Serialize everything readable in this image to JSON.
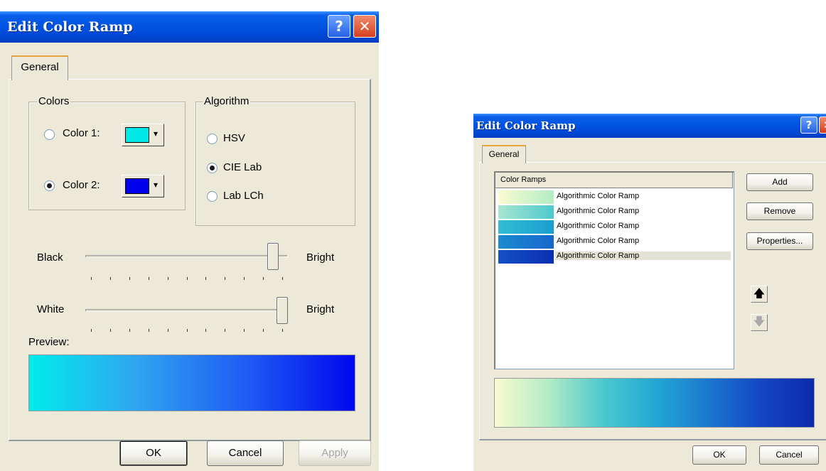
{
  "left_dialog": {
    "title": "Edit Color Ramp",
    "help_glyph": "?",
    "close_glyph": "✕",
    "tab_label": "General",
    "colors_group": {
      "legend": "Colors",
      "color1_label": "Color 1:",
      "color1_selected": false,
      "color1_value": "#00e8e8",
      "color2_label": "Color 2:",
      "color2_selected": true,
      "color2_value": "#0000ee"
    },
    "algorithm_group": {
      "legend": "Algorithm",
      "options": [
        {
          "label": "HSV",
          "selected": false
        },
        {
          "label": "CIE Lab",
          "selected": true
        },
        {
          "label": "Lab LCh",
          "selected": false
        }
      ]
    },
    "black_slider": {
      "left_label": "Black",
      "right_label": "Bright",
      "value": 0.95
    },
    "white_slider": {
      "left_label": "White",
      "right_label": "Bright",
      "value": 1.0
    },
    "preview_label": "Preview:",
    "preview_colors": [
      "#00ecec",
      "#2fa4f0",
      "#1f5cf4",
      "#0008ee"
    ],
    "buttons": {
      "ok": "OK",
      "cancel": "Cancel",
      "apply": "Apply"
    }
  },
  "right_dialog": {
    "title": "Edit Color Ramp",
    "help_glyph": "?",
    "close_glyph": "✕",
    "tab_label": "General",
    "list_header": "Color Ramps",
    "ramps": [
      {
        "label": "Algorithmic Color Ramp",
        "from": "#fbfbd2",
        "to": "#b3ecc4",
        "selected": false
      },
      {
        "label": "Algorithmic Color Ramp",
        "from": "#a8e6d0",
        "to": "#4dc9cd",
        "selected": false
      },
      {
        "label": "Algorithmic Color Ramp",
        "from": "#31bdd2",
        "to": "#1a9ed0",
        "selected": false
      },
      {
        "label": "Algorithmic Color Ramp",
        "from": "#1b8ad0",
        "to": "#1867cc",
        "selected": false
      },
      {
        "label": "Algorithmic Color Ramp",
        "from": "#1450c8",
        "to": "#0a2fb0",
        "selected": true
      }
    ],
    "buttons": {
      "add": "Add",
      "remove": "Remove",
      "properties": "Properties...",
      "ok": "OK",
      "cancel": "Cancel"
    },
    "move_up_glyph": "🡅",
    "move_down_glyph": "🡇",
    "preview_colors": [
      "#fafad0",
      "#b3ecc4",
      "#4ec9cd",
      "#22a8d3",
      "#1c78cf",
      "#1446c4",
      "#0c2aac"
    ]
  }
}
